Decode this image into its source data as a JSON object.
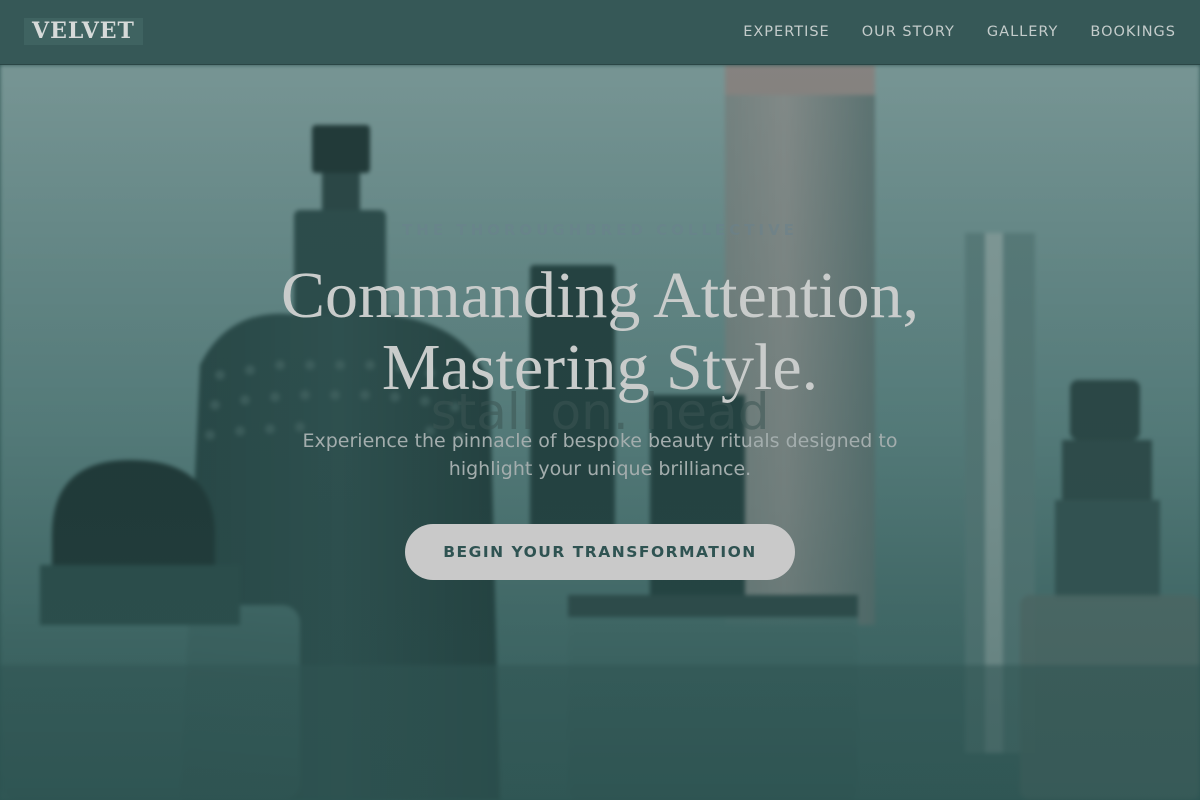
{
  "header": {
    "logo": "VELVET",
    "nav": [
      {
        "label": "EXPERTISE"
      },
      {
        "label": "OUR STORY"
      },
      {
        "label": "GALLERY"
      },
      {
        "label": "BOOKINGS"
      }
    ]
  },
  "hero": {
    "eyebrow": "THE THOROUGHBRED COLLECTIVE",
    "headline_line1": "Commanding Attention,",
    "headline_line2": "Mastering Style.",
    "ghost_text": "stall on. head",
    "subtext_line1": "Experience the pinnacle of bespoke beauty rituals designed to",
    "subtext_line2": "highlight your unique brilliance.",
    "cta_label": "BEGIN YOUR TRANSFORMATION"
  },
  "colors": {
    "header_bg": "#365857",
    "hero_tint": "#2f5654",
    "cta_bg": "#c9c9c9",
    "cta_text": "#2f5352",
    "headline": "#c9cccb"
  }
}
